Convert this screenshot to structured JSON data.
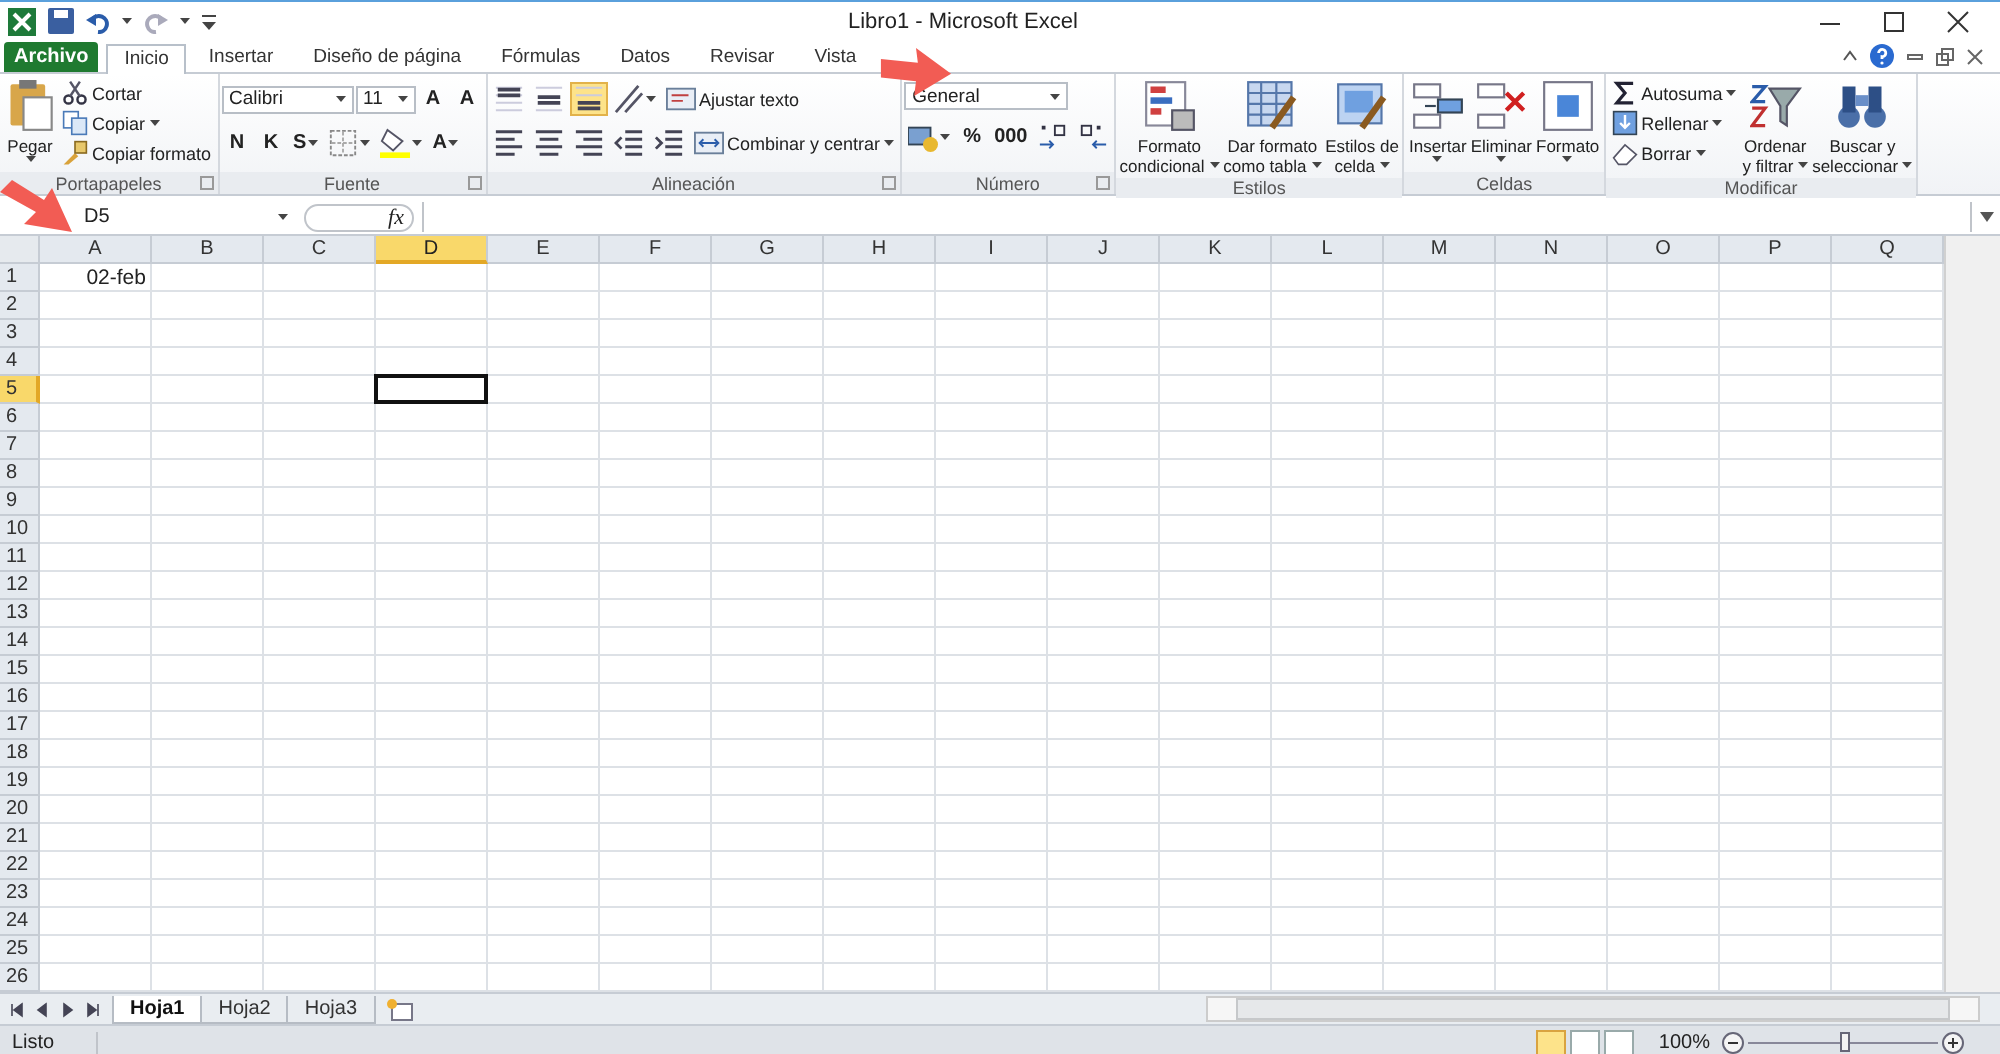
{
  "window": {
    "title": "Libro1 - Microsoft Excel"
  },
  "tabs": [
    {
      "label": "Archivo",
      "kind": "file",
      "selected": false
    },
    {
      "label": "Inicio",
      "kind": "tab",
      "selected": true
    },
    {
      "label": "Insertar",
      "kind": "tab",
      "selected": false
    },
    {
      "label": "Diseño de página",
      "kind": "tab",
      "selected": false
    },
    {
      "label": "Fórmulas",
      "kind": "tab",
      "selected": false
    },
    {
      "label": "Datos",
      "kind": "tab",
      "selected": false
    },
    {
      "label": "Revisar",
      "kind": "tab",
      "selected": false
    },
    {
      "label": "Vista",
      "kind": "tab",
      "selected": false
    }
  ],
  "ribbon": [
    {
      "label": "Portapapeles",
      "launcher": true,
      "items": [
        {
          "kind": "large",
          "label": [
            "Pegar"
          ],
          "dropdown": true
        },
        {
          "kind": "stack",
          "entries": [
            {
              "label": "Cortar",
              "dropdown": false
            },
            {
              "label": "Copiar",
              "dropdown": true
            },
            {
              "label": "Copiar formato",
              "dropdown": false
            }
          ]
        }
      ]
    },
    {
      "label": "Fuente",
      "launcher": true,
      "items": [
        {
          "kind": "rows",
          "top": [
            {
              "kind": "combo",
              "value": "Calibri"
            },
            {
              "kind": "combo",
              "value": "11"
            },
            {
              "kind": "button",
              "text": "A",
              "selected": false,
              "dropdown": false
            },
            {
              "kind": "button",
              "text": "A",
              "selected": false,
              "dropdown": false
            }
          ],
          "bottom": [
            {
              "kind": "button",
              "text": "N",
              "selected": false,
              "dropdown": false
            },
            {
              "kind": "button",
              "text": "K",
              "selected": false,
              "dropdown": false
            },
            {
              "kind": "button",
              "text": "S",
              "selected": false,
              "dropdown": true
            },
            {
              "kind": "button",
              "selected": false,
              "dropdown": true
            },
            {
              "kind": "button",
              "selected": false,
              "dropdown": true
            },
            {
              "kind": "button",
              "text": "A",
              "selected": false,
              "dropdown": true
            }
          ]
        }
      ]
    },
    {
      "label": "Alineación",
      "launcher": true,
      "items": [
        {
          "kind": "rows",
          "top": [
            {
              "kind": "button",
              "selected": false,
              "dropdown": false
            },
            {
              "kind": "button",
              "selected": false,
              "dropdown": false
            },
            {
              "kind": "button",
              "selected": true,
              "dropdown": false
            },
            {
              "kind": "button",
              "selected": false,
              "dropdown": true
            },
            {
              "kind": "labelbutton",
              "label": "Ajustar texto",
              "dropdown": false
            }
          ],
          "bottom": [
            {
              "kind": "button",
              "selected": false,
              "dropdown": false
            },
            {
              "kind": "button",
              "selected": false,
              "dropdown": false
            },
            {
              "kind": "button",
              "selected": false,
              "dropdown": false
            },
            {
              "kind": "button",
              "selected": false,
              "dropdown": false
            },
            {
              "kind": "button",
              "selected": false,
              "dropdown": false
            },
            {
              "kind": "labelbutton",
              "label": "Combinar y centrar",
              "dropdown": true
            }
          ]
        }
      ]
    },
    {
      "label": "Número",
      "launcher": true,
      "items": [
        {
          "kind": "rows",
          "top": [
            {
              "kind": "combo",
              "value": "General"
            }
          ],
          "bottom": [
            {
              "kind": "button",
              "selected": false,
              "dropdown": true
            },
            {
              "kind": "button",
              "text": "%",
              "selected": false,
              "dropdown": false
            },
            {
              "kind": "button",
              "text": "000",
              "selected": false,
              "dropdown": false
            },
            {
              "kind": "button",
              "selected": false,
              "dropdown": false
            },
            {
              "kind": "button",
              "selected": false,
              "dropdown": false
            }
          ]
        }
      ]
    },
    {
      "label": "Estilos",
      "launcher": false,
      "items": [
        {
          "kind": "large",
          "label": [
            "Formato",
            "condicional"
          ],
          "dropdown": true
        },
        {
          "kind": "large",
          "label": [
            "Dar formato",
            "como tabla"
          ],
          "dropdown": true
        },
        {
          "kind": "large",
          "label": [
            "Estilos de",
            "celda"
          ],
          "dropdown": true
        }
      ]
    },
    {
      "label": "Celdas",
      "launcher": false,
      "items": [
        {
          "kind": "large",
          "label": [
            "Insertar"
          ],
          "dropdown": true
        },
        {
          "kind": "large",
          "label": [
            "Eliminar"
          ],
          "dropdown": true
        },
        {
          "kind": "large",
          "label": [
            "Formato"
          ],
          "dropdown": true
        }
      ]
    },
    {
      "label": "Modificar",
      "launcher": false,
      "items": [
        {
          "kind": "stack",
          "entries": [
            {
              "label": "Autosuma",
              "dropdown": true
            },
            {
              "label": "Rellenar",
              "dropdown": true
            },
            {
              "label": "Borrar",
              "dropdown": true
            }
          ]
        },
        {
          "kind": "large",
          "label": [
            "Ordenar",
            "y filtrar"
          ],
          "dropdown": true
        },
        {
          "kind": "large",
          "label": [
            "Buscar y",
            "seleccionar"
          ],
          "dropdown": true
        }
      ]
    }
  ],
  "formula_bar": {
    "name_box": "D5",
    "fx": "fx"
  },
  "columns": [
    {
      "label": "A",
      "selected": false
    },
    {
      "label": "B",
      "selected": false
    },
    {
      "label": "C",
      "selected": false
    },
    {
      "label": "D",
      "selected": true
    },
    {
      "label": "E",
      "selected": false
    },
    {
      "label": "F",
      "selected": false
    },
    {
      "label": "G",
      "selected": false
    },
    {
      "label": "H",
      "selected": false
    },
    {
      "label": "I",
      "selected": false
    },
    {
      "label": "J",
      "selected": false
    },
    {
      "label": "K",
      "selected": false
    },
    {
      "label": "L",
      "selected": false
    },
    {
      "label": "M",
      "selected": false
    },
    {
      "label": "N",
      "selected": false
    },
    {
      "label": "O",
      "selected": false
    },
    {
      "label": "P",
      "selected": false
    },
    {
      "label": "Q",
      "selected": false
    }
  ],
  "rows": [
    {
      "label": "1",
      "selected": false,
      "cells": [
        "02-feb"
      ]
    },
    {
      "label": "2",
      "selected": false
    },
    {
      "label": "3",
      "selected": false
    },
    {
      "label": "4",
      "selected": false
    },
    {
      "label": "5",
      "selected": true
    },
    {
      "label": "6",
      "selected": false
    },
    {
      "label": "7",
      "selected": false
    },
    {
      "label": "8",
      "selected": false
    },
    {
      "label": "9",
      "selected": false
    },
    {
      "label": "10",
      "selected": false
    },
    {
      "label": "11",
      "selected": false
    },
    {
      "label": "12",
      "selected": false
    },
    {
      "label": "13",
      "selected": false
    },
    {
      "label": "14",
      "selected": false
    },
    {
      "label": "15",
      "selected": false
    },
    {
      "label": "16",
      "selected": false
    },
    {
      "label": "17",
      "selected": false
    },
    {
      "label": "18",
      "selected": false
    },
    {
      "label": "19",
      "selected": false
    },
    {
      "label": "20",
      "selected": false
    },
    {
      "label": "21",
      "selected": false
    },
    {
      "label": "22",
      "selected": false
    },
    {
      "label": "23",
      "selected": false
    },
    {
      "label": "24",
      "selected": false
    },
    {
      "label": "25",
      "selected": false
    },
    {
      "label": "26",
      "selected": false
    }
  ],
  "sheets": [
    {
      "label": "Hoja1",
      "selected": true
    },
    {
      "label": "Hoja2",
      "selected": false
    },
    {
      "label": "Hoja3",
      "selected": false
    }
  ],
  "status_bar": {
    "status": "Listo",
    "views": [
      {
        "selected": true
      },
      {
        "selected": false
      },
      {
        "selected": false
      }
    ],
    "zoom": "100%",
    "zoom_slider": {
      "level": 0.5
    }
  }
}
